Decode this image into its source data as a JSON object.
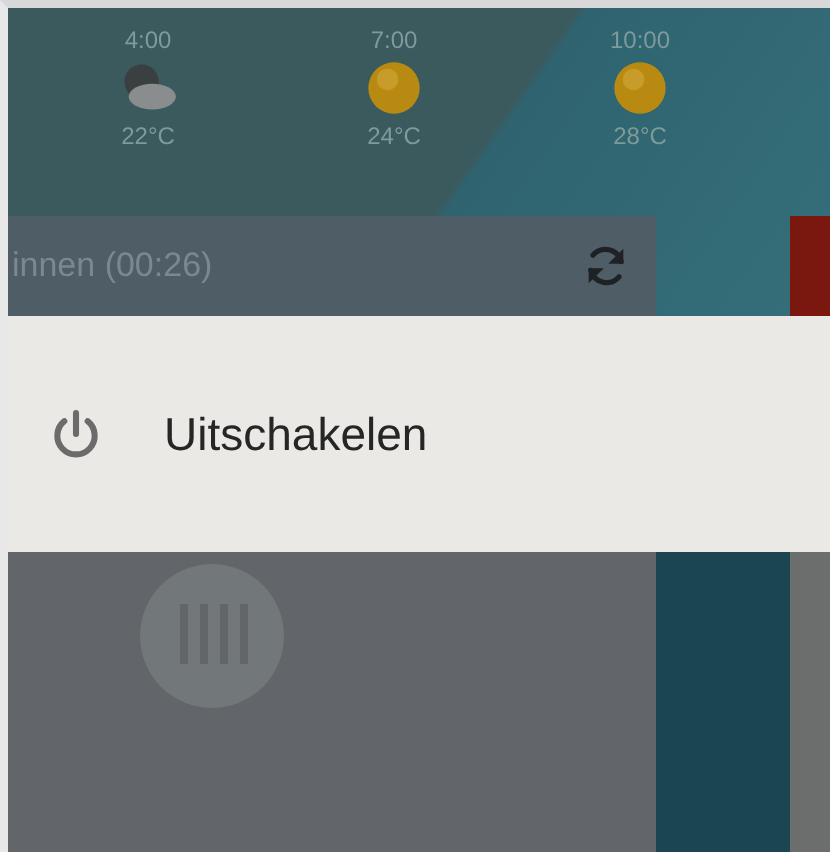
{
  "forecast": [
    {
      "time": "4:00",
      "kind": "cloudy-night",
      "temperature": "22°C"
    },
    {
      "time": "7:00",
      "kind": "sunny",
      "temperature": "24°C"
    },
    {
      "time": "10:00",
      "kind": "sunny",
      "temperature": "28°C"
    }
  ],
  "timer_card": {
    "label": "innen (00:26)"
  },
  "menu": {
    "items": [
      {
        "label": "Uitschakelen"
      }
    ]
  }
}
